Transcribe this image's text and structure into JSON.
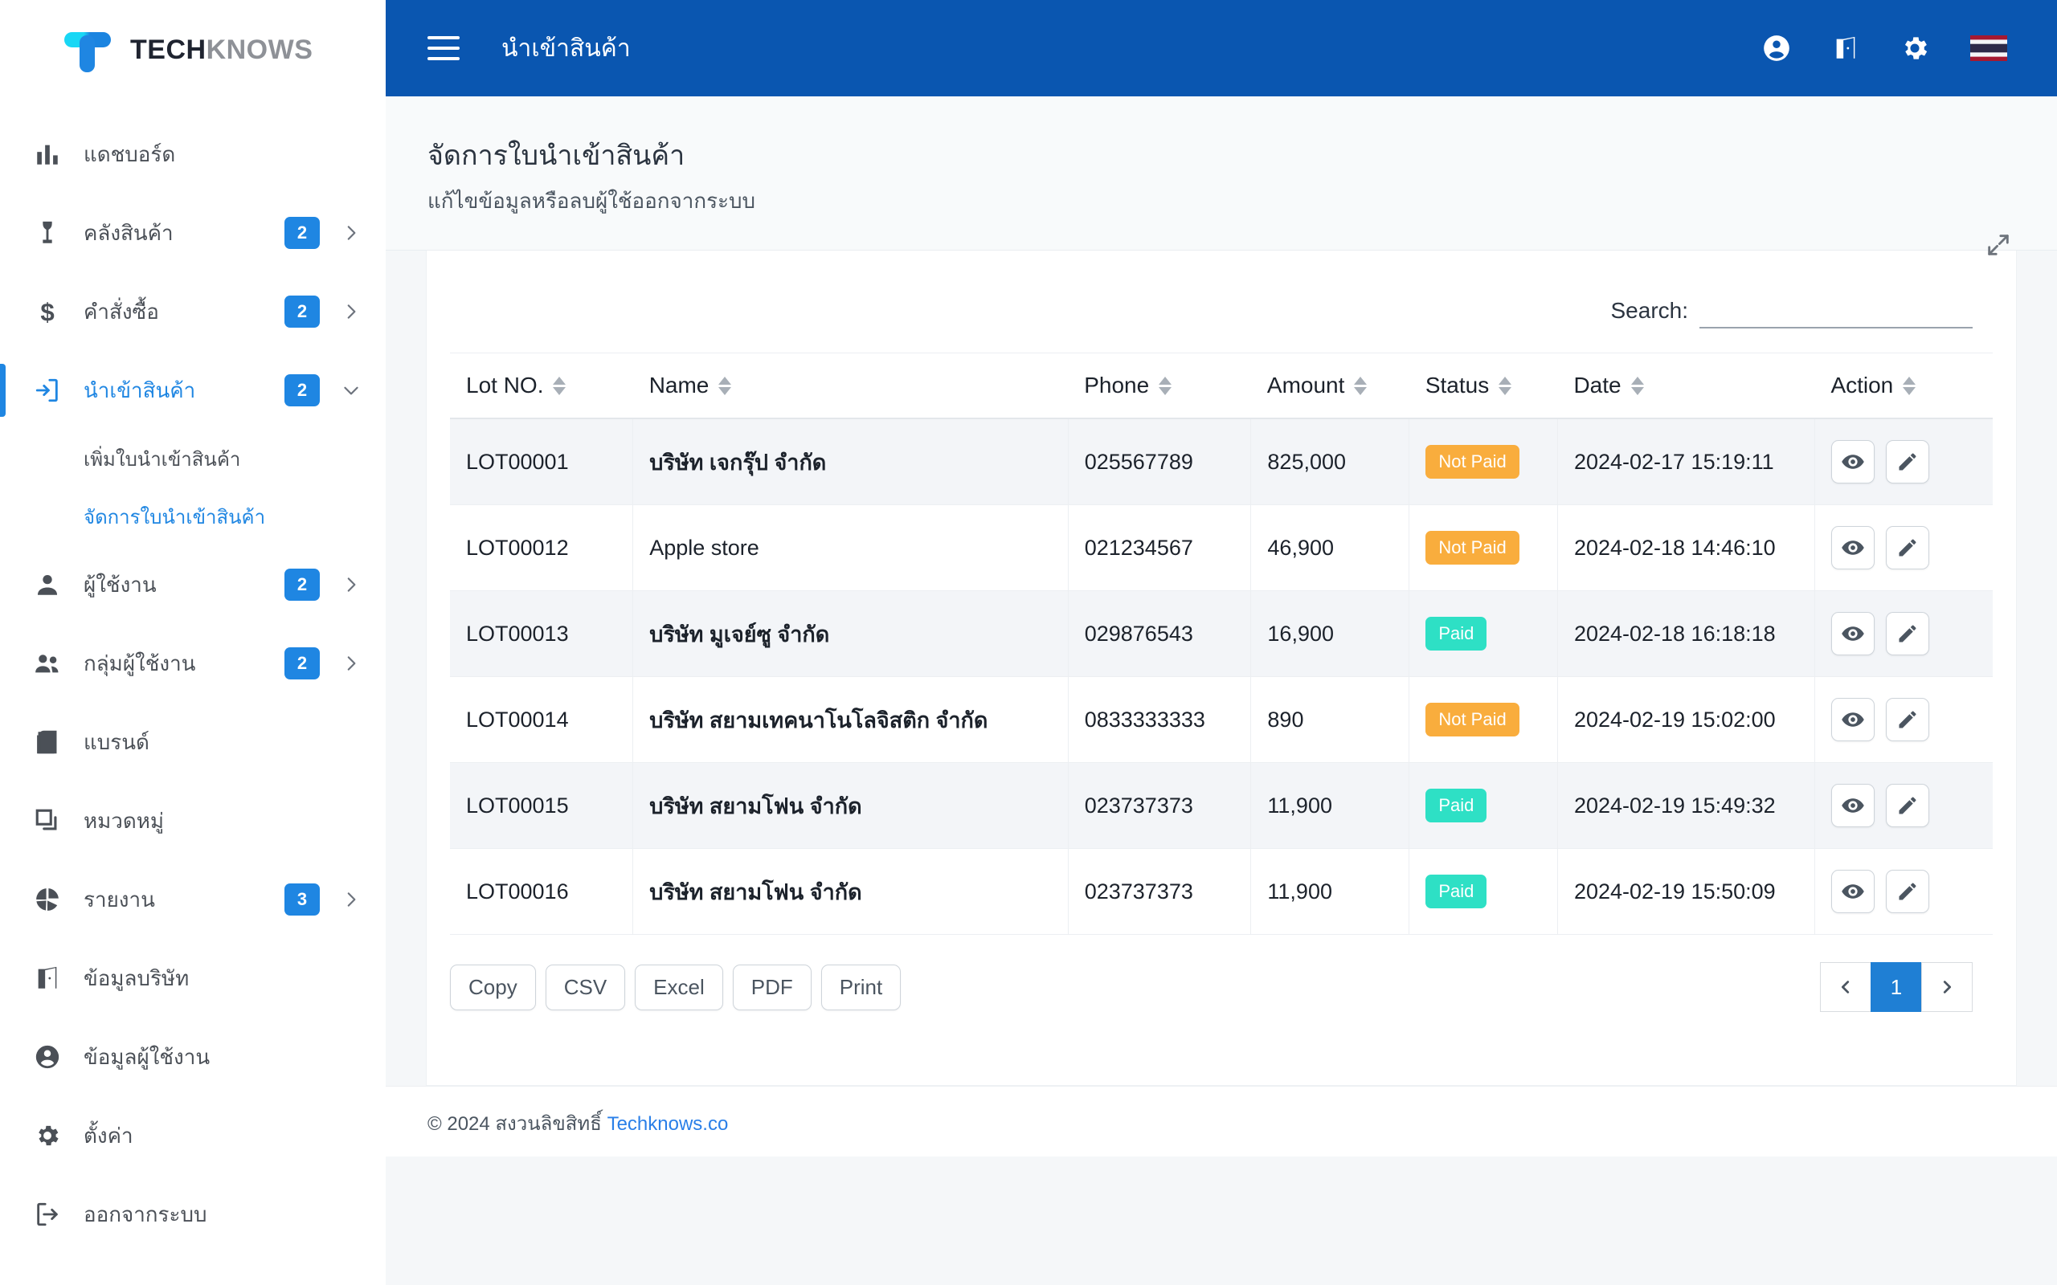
{
  "brand": {
    "text_primary": "TECH",
    "text_secondary": "KNOWS",
    "accent": "#1f86e2"
  },
  "topbar": {
    "title": "นำเข้าสินค้า",
    "background": "#0a56b0",
    "icons": [
      "account-circle-icon",
      "company-icon",
      "gear-icon",
      "thai-flag-icon"
    ]
  },
  "sidebar": {
    "items": [
      {
        "label": "แดชบอร์ด",
        "icon": "bar-chart-icon",
        "badge": "",
        "chevron": false,
        "active": false
      },
      {
        "label": "คลังสินค้า",
        "icon": "warehouse-icon",
        "badge": "2",
        "chevron": true,
        "active": false
      },
      {
        "label": "คำสั่งซื้อ",
        "icon": "dollar-icon",
        "badge": "2",
        "chevron": true,
        "active": false
      },
      {
        "label": "นำเข้าสินค้า",
        "icon": "import-icon",
        "badge": "2",
        "chevron": true,
        "active": true
      },
      {
        "label": "ผู้ใช้งาน",
        "icon": "person-icon",
        "badge": "2",
        "chevron": true,
        "active": false
      },
      {
        "label": "กลุ่มผู้ใช้งาน",
        "icon": "people-icon",
        "badge": "2",
        "chevron": true,
        "active": false
      },
      {
        "label": "แบรนด์",
        "icon": "book-icon",
        "badge": "",
        "chevron": false,
        "active": false
      },
      {
        "label": "หมวดหมู่",
        "icon": "category-icon",
        "badge": "",
        "chevron": false,
        "active": false
      },
      {
        "label": "รายงาน",
        "icon": "pie-chart-icon",
        "badge": "3",
        "chevron": true,
        "active": false
      },
      {
        "label": "ข้อมูลบริษัท",
        "icon": "company-icon",
        "badge": "",
        "chevron": false,
        "active": false
      },
      {
        "label": "ข้อมูลผู้ใช้งาน",
        "icon": "account-circle-icon",
        "badge": "",
        "chevron": false,
        "active": false
      },
      {
        "label": "ตั้งค่า",
        "icon": "gear-icon",
        "badge": "",
        "chevron": false,
        "active": false
      },
      {
        "label": "ออกจากระบบ",
        "icon": "logout-icon",
        "badge": "",
        "chevron": false,
        "active": false
      }
    ],
    "subitems": [
      {
        "label": "เพิ่มใบนำเข้าสินค้า",
        "active": false
      },
      {
        "label": "จัดการใบนำเข้าสินค้า",
        "active": true
      }
    ]
  },
  "page": {
    "title": "จัดการใบนำเข้าสินค้า",
    "subtitle": "แก้ไขข้อมูลหรือลบผู้ใช้ออกจากระบบ",
    "expand_icon": "expand-arrows-icon"
  },
  "search": {
    "label": "Search:",
    "value": "",
    "placeholder": ""
  },
  "table": {
    "columns": [
      "Lot NO.",
      "Name",
      "Phone",
      "Amount",
      "Status",
      "Date",
      "Action"
    ],
    "rows": [
      {
        "lot": "LOT00001",
        "name": "บริษัท เจกรุ๊ป จำกัด",
        "name_bold": true,
        "phone": "025567789",
        "amount": "825,000",
        "status": "Not Paid",
        "status_kind": "notpaid",
        "date": "2024-02-17 15:19:11"
      },
      {
        "lot": "LOT00012",
        "name": "Apple store",
        "name_bold": false,
        "phone": "021234567",
        "amount": "46,900",
        "status": "Not Paid",
        "status_kind": "notpaid",
        "date": "2024-02-18 14:46:10"
      },
      {
        "lot": "LOT00013",
        "name": "บริษัท มูเจย์ซู จำกัด",
        "name_bold": true,
        "phone": "029876543",
        "amount": "16,900",
        "status": "Paid",
        "status_kind": "paid",
        "date": "2024-02-18 16:18:18"
      },
      {
        "lot": "LOT00014",
        "name": "บริษัท สยามเทคนาโนโลจิสติก จำกัด",
        "name_bold": true,
        "phone": "0833333333",
        "amount": "890",
        "status": "Not Paid",
        "status_kind": "notpaid",
        "date": "2024-02-19 15:02:00"
      },
      {
        "lot": "LOT00015",
        "name": "บริษัท สยามโฟน จำกัด",
        "name_bold": true,
        "phone": "023737373",
        "amount": "11,900",
        "status": "Paid",
        "status_kind": "paid",
        "date": "2024-02-19 15:49:32"
      },
      {
        "lot": "LOT00016",
        "name": "บริษัท สยามโฟน จำกัด",
        "name_bold": true,
        "phone": "023737373",
        "amount": "11,900",
        "status": "Paid",
        "status_kind": "paid",
        "date": "2024-02-19 15:50:09"
      }
    ],
    "row_actions": [
      "view-icon",
      "edit-icon"
    ]
  },
  "exports": [
    "Copy",
    "CSV",
    "Excel",
    "PDF",
    "Print"
  ],
  "pagination": {
    "prev": "‹",
    "pages": [
      "1"
    ],
    "next": "›",
    "current": "1",
    "active_color": "#1f7fd4"
  },
  "footer": {
    "copyright": "© 2024 สงวนลิขสิทธิ์ ",
    "link": "Techknows.co"
  },
  "colors": {
    "paid": "#2ee0c5",
    "not_paid": "#f9ad3d",
    "primary": "#0a56b0",
    "accent": "#1f86e2"
  }
}
